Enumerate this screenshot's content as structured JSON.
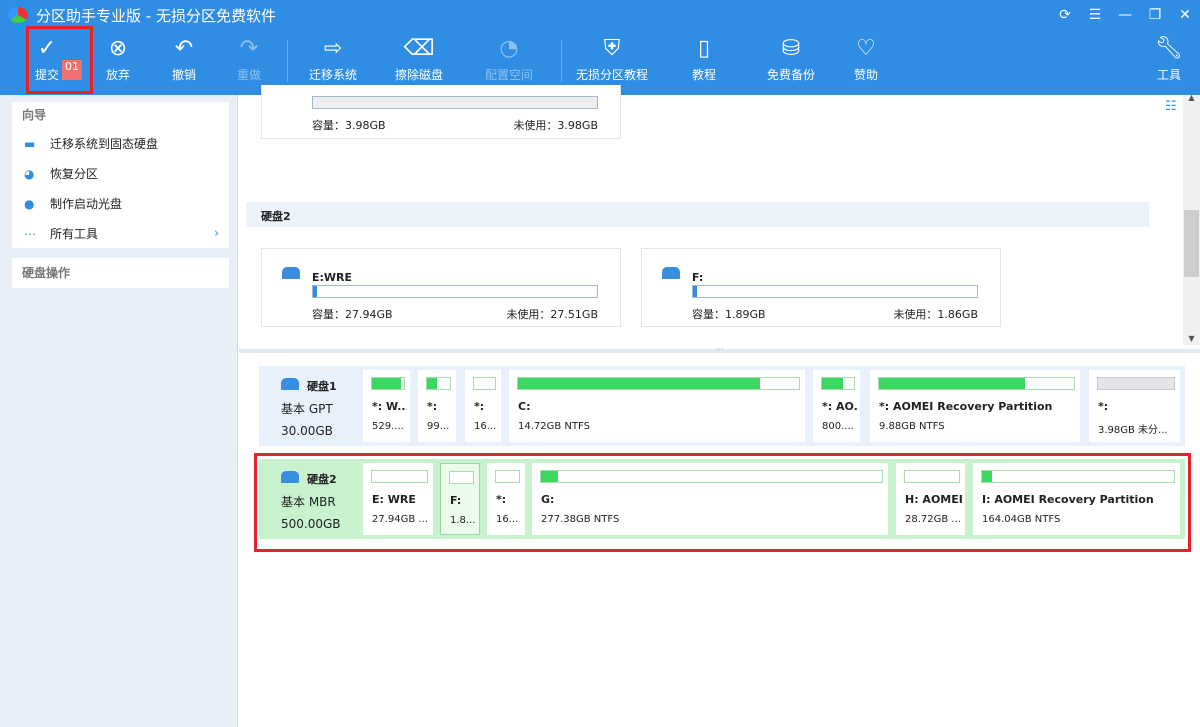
{
  "title": "分区助手专业版 - 无损分区免费软件",
  "toolbar": {
    "commit": "提交",
    "pending_count": "01",
    "discard": "放弃",
    "undo": "撤销",
    "redo": "重做",
    "migrate": "迁移系统",
    "wipe": "擦除磁盘",
    "allocate": "配置空间",
    "tutorial_lossless": "无损分区教程",
    "tutorial": "教程",
    "backup": "免费备份",
    "sponsor": "赞助",
    "tools": "工具"
  },
  "sidebar": {
    "wizard_title": "向导",
    "items": [
      {
        "label": "迁移系统到固态硬盘"
      },
      {
        "label": "恢复分区"
      },
      {
        "label": "制作启动光盘"
      },
      {
        "label": "所有工具"
      }
    ],
    "disk_ops_title": "硬盘操作"
  },
  "cards": {
    "top": {
      "capacity": "容量：3.98GB",
      "unused": "未使用：3.98GB"
    },
    "disk2_header": "硬盘2",
    "e": {
      "name": "E:WRE",
      "capacity": "容量：27.94GB",
      "unused": "未使用：27.51GB",
      "used_fraction": 0.015
    },
    "f": {
      "name": "F:",
      "capacity": "容量：1.89GB",
      "unused": "未使用：1.86GB",
      "used_fraction": 0.015
    }
  },
  "disks": [
    {
      "name": "硬盘1",
      "type": "基本 GPT",
      "size": "30.00GB",
      "partitions": [
        {
          "name": "*: W...",
          "size": "529....",
          "used": 0.9
        },
        {
          "name": "*:",
          "size": "99...",
          "used": 0.45
        },
        {
          "name": "*:",
          "size": "16...",
          "used": 0
        },
        {
          "name": "C:",
          "size": "14.72GB NTFS",
          "used": 0.86
        },
        {
          "name": "*: AO...",
          "size": "800....",
          "used": 0.65
        },
        {
          "name": "*: AOMEI Recovery Partition",
          "size": "9.88GB NTFS",
          "used": 0.75
        },
        {
          "name": "*:",
          "size": "3.98GB 未分...",
          "used": 0
        }
      ]
    },
    {
      "name": "硬盘2",
      "type": "基本 MBR",
      "size": "500.00GB",
      "partitions": [
        {
          "name": "E: WRE",
          "size": "27.94GB ...",
          "used": 0
        },
        {
          "name": "F:",
          "size": "1.8...",
          "used": 0
        },
        {
          "name": "*:",
          "size": "16...",
          "used": 0
        },
        {
          "name": "G:",
          "size": "277.38GB NTFS",
          "used": 0.05
        },
        {
          "name": "H: AOMEI",
          "size": "28.72GB ...",
          "used": 0
        },
        {
          "name": "I: AOMEI Recovery Partition",
          "size": "164.04GB NTFS",
          "used": 0.05
        }
      ]
    }
  ]
}
